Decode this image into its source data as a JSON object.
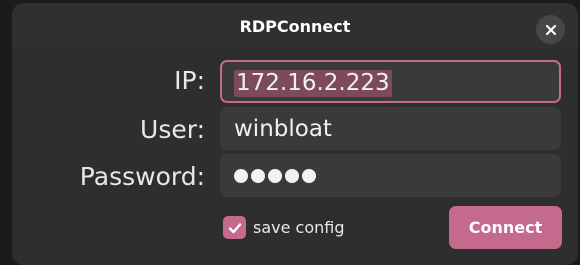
{
  "window": {
    "title": "RDPConnect"
  },
  "form": {
    "ip_label": "IP:",
    "ip_value": "172.16.2.223",
    "user_label": "User:",
    "user_value": "winbloat",
    "password_label": "Password:",
    "password_length": 5,
    "save_config_label": "save config",
    "save_config_checked": true,
    "connect_label": "Connect"
  },
  "icons": {
    "close": "close-icon",
    "check": "checkmark-icon"
  },
  "colors": {
    "accent": "#c46a8d",
    "selection": "#7d4a5c",
    "window_bg": "#2e2e2e",
    "field_bg": "#3a3a3a"
  }
}
